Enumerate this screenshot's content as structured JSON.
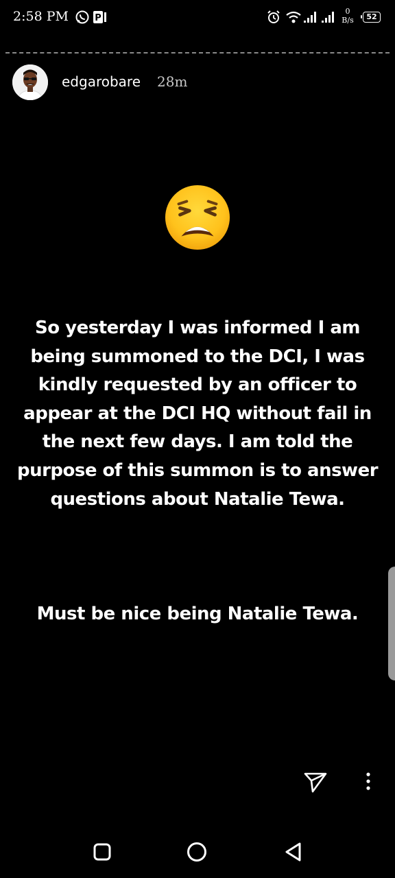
{
  "status_bar": {
    "time": "2:58 PM",
    "net_speed_value": "0",
    "net_speed_unit": "B/s",
    "battery": "52",
    "icons": [
      "whatsapp-icon",
      "parking-icon",
      "alarm-icon",
      "wifi-icon",
      "signal-icon",
      "signal-icon-2"
    ]
  },
  "story": {
    "username": "edgarobare",
    "time_ago": "28m",
    "emoji": "weary-face-emoji",
    "text_lines": [
      "So yesterday I was informed I am",
      "being summoned to the DCI, I was",
      "kindly requested by an officer to",
      "appear at the DCI HQ without fail in",
      "the next few days. I am told the",
      "purpose of this summon is to answer",
      "questions about Natalie Tewa."
    ],
    "text_2": "Must be nice being Natalie Tewa."
  },
  "actions": {
    "icons": [
      "send-icon",
      "more-icon"
    ]
  },
  "nav_bar": {
    "icons": [
      "recents-square-icon",
      "home-circle-icon",
      "back-triangle-icon"
    ]
  }
}
